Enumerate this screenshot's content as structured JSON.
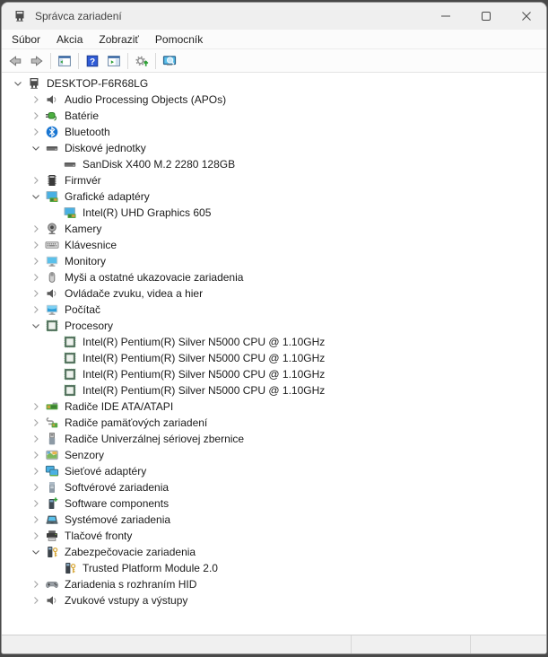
{
  "window": {
    "title": "Správca zariadení",
    "app_icon": "device-manager",
    "controls": [
      {
        "name": "minimize",
        "icon": "minimize-glyph"
      },
      {
        "name": "maximize",
        "icon": "maximize-glyph"
      },
      {
        "name": "close",
        "icon": "close-glyph"
      }
    ]
  },
  "menu": {
    "items": [
      {
        "label": "Súbor"
      },
      {
        "label": "Akcia"
      },
      {
        "label": "Zobraziť"
      },
      {
        "label": "Pomocník"
      }
    ]
  },
  "toolbar": {
    "buttons": [
      {
        "type": "button",
        "icon": "back-arrow"
      },
      {
        "type": "button",
        "icon": "forward-arrow"
      },
      {
        "type": "separator"
      },
      {
        "type": "button",
        "icon": "console-tree-window"
      },
      {
        "type": "separator"
      },
      {
        "type": "button",
        "icon": "help-question"
      },
      {
        "type": "button",
        "icon": "action-pane-window"
      },
      {
        "type": "separator"
      },
      {
        "type": "button",
        "icon": "gear-update"
      },
      {
        "type": "separator"
      },
      {
        "type": "button",
        "icon": "computer-search"
      }
    ]
  },
  "tree": {
    "items": [
      {
        "label": "DESKTOP-F6R68LG",
        "level": 0,
        "state": "expanded",
        "icon": "computer-root"
      },
      {
        "label": "Audio Processing Objects (APOs)",
        "level": 1,
        "state": "collapsed",
        "icon": "speaker"
      },
      {
        "label": "Batérie",
        "level": 1,
        "state": "collapsed",
        "icon": "battery"
      },
      {
        "label": "Bluetooth",
        "level": 1,
        "state": "collapsed",
        "icon": "bluetooth"
      },
      {
        "label": "Diskové jednotky",
        "level": 1,
        "state": "expanded",
        "icon": "disk"
      },
      {
        "label": "SanDisk X400 M.2 2280 128GB",
        "level": 2,
        "state": "leaf",
        "icon": "disk"
      },
      {
        "label": "Firmvér",
        "level": 1,
        "state": "collapsed",
        "icon": "firmware"
      },
      {
        "label": "Grafické adaptéry",
        "level": 1,
        "state": "expanded",
        "icon": "display-adapter"
      },
      {
        "label": "Intel(R) UHD Graphics 605",
        "level": 2,
        "state": "leaf",
        "icon": "display-adapter"
      },
      {
        "label": "Kamery",
        "level": 1,
        "state": "collapsed",
        "icon": "camera"
      },
      {
        "label": "Klávesnice",
        "level": 1,
        "state": "collapsed",
        "icon": "keyboard"
      },
      {
        "label": "Monitory",
        "level": 1,
        "state": "collapsed",
        "icon": "monitor"
      },
      {
        "label": "Myši a ostatné ukazovacie zariadenia",
        "level": 1,
        "state": "collapsed",
        "icon": "mouse"
      },
      {
        "label": "Ovládače zvuku, videa a hier",
        "level": 1,
        "state": "collapsed",
        "icon": "speaker"
      },
      {
        "label": "Počítač",
        "level": 1,
        "state": "collapsed",
        "icon": "computer"
      },
      {
        "label": "Procesory",
        "level": 1,
        "state": "expanded",
        "icon": "cpu"
      },
      {
        "label": "Intel(R) Pentium(R) Silver N5000 CPU @ 1.10GHz",
        "level": 2,
        "state": "leaf",
        "icon": "cpu"
      },
      {
        "label": "Intel(R) Pentium(R) Silver N5000 CPU @ 1.10GHz",
        "level": 2,
        "state": "leaf",
        "icon": "cpu"
      },
      {
        "label": "Intel(R) Pentium(R) Silver N5000 CPU @ 1.10GHz",
        "level": 2,
        "state": "leaf",
        "icon": "cpu"
      },
      {
        "label": "Intel(R) Pentium(R) Silver N5000 CPU @ 1.10GHz",
        "level": 2,
        "state": "leaf",
        "icon": "cpu"
      },
      {
        "label": "Radiče IDE ATA/ATAPI",
        "level": 1,
        "state": "collapsed",
        "icon": "ide-controller"
      },
      {
        "label": "Radiče pamäťových zariadení",
        "level": 1,
        "state": "collapsed",
        "icon": "storage-controller"
      },
      {
        "label": "Radiče Univerzálnej sériovej zbernice",
        "level": 1,
        "state": "collapsed",
        "icon": "usb"
      },
      {
        "label": "Senzory",
        "level": 1,
        "state": "collapsed",
        "icon": "sensor"
      },
      {
        "label": "Sieťové adaptéry",
        "level": 1,
        "state": "collapsed",
        "icon": "network"
      },
      {
        "label": "Softvérové zariadenia",
        "level": 1,
        "state": "collapsed",
        "icon": "software-device"
      },
      {
        "label": "Software components",
        "level": 1,
        "state": "collapsed",
        "icon": "software-component"
      },
      {
        "label": "Systémové zariadenia",
        "level": 1,
        "state": "collapsed",
        "icon": "system-device"
      },
      {
        "label": "Tlačové fronty",
        "level": 1,
        "state": "collapsed",
        "icon": "printer"
      },
      {
        "label": "Zabezpečovacie zariadenia",
        "level": 1,
        "state": "expanded",
        "icon": "security-device"
      },
      {
        "label": "Trusted Platform Module 2.0",
        "level": 2,
        "state": "leaf",
        "icon": "security-device"
      },
      {
        "label": "Zariadenia s rozhraním HID",
        "level": 1,
        "state": "collapsed",
        "icon": "gamepad"
      },
      {
        "label": "Zvukové vstupy a výstupy",
        "level": 1,
        "state": "collapsed",
        "icon": "speaker"
      }
    ]
  },
  "statusbar": {
    "segments": [
      "",
      "",
      ""
    ]
  },
  "colors": {
    "titlebar_bg": "#efefef",
    "content_bg": "#ffffff",
    "statusbar_bg": "#f0f0f0",
    "bluetooth_blue": "#1976d2",
    "device_green": "#57a844",
    "screen_blue": "#49b0e3",
    "key_gold": "#d8a93c"
  }
}
